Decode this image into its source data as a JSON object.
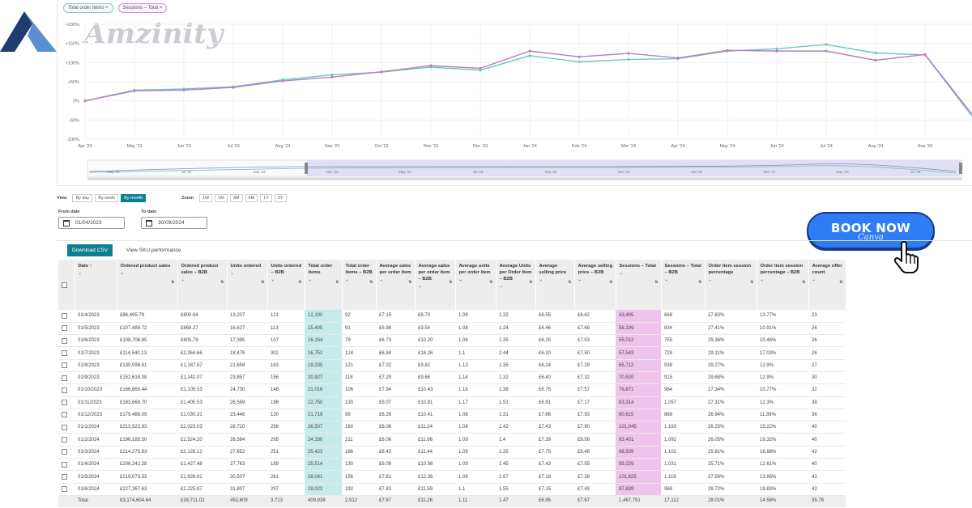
{
  "brand": {
    "wordmark": "Amzinity",
    "colors": {
      "logo_dark": "#1f3d6e",
      "logo_light": "#5a8fd0",
      "wordmark": "#c9ccd3"
    }
  },
  "chart": {
    "chips": [
      "Total order items ×",
      "Sessions – Total ×"
    ],
    "colors": {
      "teal": "#6cc7bf",
      "pink": "#c07bc0",
      "navigator_fill": "#d9d9f2"
    }
  },
  "chart_data": {
    "type": "line",
    "categories": [
      "Apr '23",
      "May '23",
      "Jun '23",
      "Jul '23",
      "Aug '23",
      "Sep '23",
      "Oct '23",
      "Nov '23",
      "Dec '23",
      "Jan '24",
      "Feb '24",
      "Mar '24",
      "Apr '24",
      "May '24",
      "Jun '24",
      "Jul '24",
      "Aug '24",
      "Sep '24"
    ],
    "y_ticks": [
      "+200%",
      "+150%",
      "+100%",
      "+50%",
      "0%",
      "-50%",
      "-100%"
    ],
    "ylim": [
      -100,
      200
    ],
    "series": [
      {
        "name": "Total order items",
        "color": "#6cc7bf",
        "values": [
          0,
          28,
          31,
          37,
          55,
          68,
          75,
          88,
          80,
          118,
          102,
          108,
          110,
          130,
          136,
          147,
          125,
          120,
          -40
        ]
      },
      {
        "name": "Sessions – Total",
        "color": "#c07bc0",
        "values": [
          0,
          26,
          28,
          35,
          52,
          62,
          76,
          92,
          85,
          130,
          115,
          124,
          112,
          132,
          130,
          130,
          106,
          121,
          -35
        ]
      }
    ],
    "x_end_label": "",
    "navigator_labels": [
      "May '22",
      "Jul '22",
      "Sep '22",
      "Nov '22",
      "May '23",
      "Jul '23",
      "Sep '23",
      "Nov '23",
      "Jan '24",
      "Mar '24",
      "May '24",
      "Jul '24"
    ]
  },
  "controls": {
    "view_label": "View",
    "view_options": [
      "By day",
      "By week",
      "By month"
    ],
    "view_active": "By month",
    "zoom_label": "Zoom",
    "zoom_options": [
      "1W",
      "1M",
      "3M",
      "6M",
      "1Y",
      "2Y"
    ],
    "from_label": "From date",
    "from_value": "01/04/2023",
    "to_label": "To date",
    "to_value": "30/09/2024"
  },
  "cta": {
    "label": "BOOK NOW",
    "sub": "Canva"
  },
  "tabs": {
    "download": "Download CSV",
    "sku": "View SKU performance"
  },
  "table": {
    "headers": [
      "Date",
      "Ordered product sales",
      "Ordered product sales – B2B",
      "Units ordered",
      "Units ordered – B2B",
      "Total order items",
      "Total order items – B2B",
      "Average sales per order item",
      "Average sales per order item – B2B",
      "Average units per order item",
      "Average Units per Order Item – B2B",
      "Average selling price",
      "Average selling price – B2B",
      "Sessions – Total",
      "Sessions – Total – B2B",
      "Order item session percentage",
      "Order item session percentage – B2B",
      "Average offer count"
    ],
    "rows": [
      [
        "01/4/2023",
        "£86,495.79",
        "£800.64",
        "13,207",
        "121",
        "12,100",
        "92",
        "£7.15",
        "£8.70",
        "1.09",
        "1.32",
        "£6.55",
        "£6.62",
        "43,485",
        "668",
        "27.83%",
        "13.77%",
        "23"
      ],
      [
        "01/5/2023",
        "£107,489.72",
        "£868.27",
        "16,627",
        "113",
        "15,405",
        "91",
        "£6.98",
        "£9.54",
        "1.08",
        "1.24",
        "£6.46",
        "£7.68",
        "56,199",
        "834",
        "27.41%",
        "10.91%",
        "26"
      ],
      [
        "01/6/2023",
        "£108,706.85",
        "£805.79",
        "17,395",
        "107",
        "16,154",
        "79",
        "£6.73",
        "£10.20",
        "1.08",
        "1.35",
        "£6.25",
        "£7.53",
        "55,012",
        "755",
        "29.36%",
        "10.46%",
        "26"
      ],
      [
        "01/7/2023",
        "£114,540.13",
        "£2,264.66",
        "18,478",
        "302",
        "16,752",
        "124",
        "£6.84",
        "£18.26",
        "1.1",
        "2.44",
        "£6.20",
        "£7.50",
        "57,543",
        "728",
        "29.11%",
        "17.03%",
        "26"
      ],
      [
        "01/8/2023",
        "£135,096.81",
        "£1,187.67",
        "21,658",
        "163",
        "19,235",
        "121",
        "£7.02",
        "£9.82",
        "1.13",
        "1.35",
        "£6.24",
        "£7.29",
        "65,712",
        "938",
        "29.27%",
        "12.9%",
        "27"
      ],
      [
        "01/9/2023",
        "£152,618.08",
        "£1,142.07",
        "23,857",
        "156",
        "20,927",
        "118",
        "£7.29",
        "£9.68",
        "1.14",
        "1.32",
        "£6.40",
        "£7.32",
        "70,520",
        "915",
        "29.68%",
        "12.9%",
        "30"
      ],
      [
        "01/10/2023",
        "£166,860.44",
        "£1,105.53",
        "24,730",
        "146",
        "21,016",
        "106",
        "£7.94",
        "£10.43",
        "1.18",
        "1.38",
        "£6.75",
        "£7.57",
        "76,871",
        "984",
        "27.34%",
        "10.77%",
        "32"
      ],
      [
        "01/11/2023",
        "£183,668.70",
        "£1,405.53",
        "26,569",
        "196",
        "22,750",
        "130",
        "£8.07",
        "£10.81",
        "1.17",
        "1.51",
        "£6.91",
        "£7.17",
        "83,314",
        "1,057",
        "27.31%",
        "12.3%",
        "38"
      ],
      [
        "01/12/2023",
        "£179,488.09",
        "£1,030.31",
        "23,446",
        "130",
        "21,719",
        "99",
        "£8.26",
        "£10.41",
        "1.08",
        "1.31",
        "£7.66",
        "£7.93",
        "80,615",
        "869",
        "26.94%",
        "11.39%",
        "36"
      ],
      [
        "01/1/2024",
        "£213,522.83",
        "£2,023.03",
        "28,720",
        "256",
        "26,507",
        "180",
        "£8.06",
        "£11.24",
        "1.08",
        "1.42",
        "£7.43",
        "£7.90",
        "101,045",
        "1,183",
        "26.23%",
        "15.22%",
        "40"
      ],
      [
        "01/2/2024",
        "£196,185.50",
        "£2,524.20",
        "26,564",
        "295",
        "24,330",
        "211",
        "£8.06",
        "£11.96",
        "1.09",
        "1.4",
        "£7.39",
        "£8.56",
        "93,401",
        "1,092",
        "26.05%",
        "19.32%",
        "40"
      ],
      [
        "01/3/2024",
        "£214,275.83",
        "£2,128.12",
        "27,652",
        "251",
        "25,423",
        "186",
        "£8.43",
        "£11.44",
        "1.09",
        "1.35",
        "£7.75",
        "£8.48",
        "98,509",
        "1,102",
        "25.81%",
        "16.88%",
        "42"
      ],
      [
        "01/4/2024",
        "£206,242.28",
        "£1,427.48",
        "27,763",
        "189",
        "25,514",
        "130",
        "£8.08",
        "£10.98",
        "1.09",
        "1.45",
        "£7.43",
        "£7.55",
        "99,229",
        "1,031",
        "25.71%",
        "12.61%",
        "40"
      ],
      [
        "01/5/2024",
        "£219,073.53",
        "£1,928.81",
        "30,507",
        "261",
        "28,041",
        "156",
        "£7.81",
        "£12.36",
        "1.09",
        "1.67",
        "£7.18",
        "£7.39",
        "101,625",
        "1,118",
        "27.59%",
        "13.95%",
        "43"
      ],
      [
        "01/6/2024",
        "£227,367.63",
        "£2,225.87",
        "31,807",
        "297",
        "29,023",
        "192",
        "£7.83",
        "£11.59",
        "1.1",
        "1.55",
        "£7.15",
        "£7.49",
        "97,639",
        "968",
        "29.72%",
        "19.83%",
        "42"
      ]
    ],
    "total": [
      "Total",
      "£3,174,604.64",
      "£28,711.02",
      "452,609",
      "3,713",
      "409,838",
      "2,512",
      "£7.67",
      "£11.26",
      "1.11",
      "1.47",
      "£6.95",
      "£7.67",
      "1,467,751",
      "17,112",
      "28.01%",
      "14.58%",
      "35.78"
    ]
  }
}
